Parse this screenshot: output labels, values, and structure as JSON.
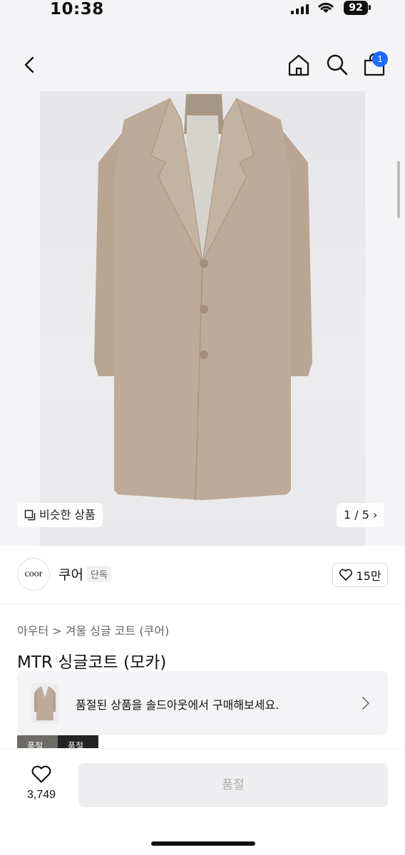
{
  "status": {
    "time": "10:38",
    "battery": "92"
  },
  "header": {
    "cart_count": "1"
  },
  "hero": {
    "similar_label": "비슷한 상품",
    "pager": "1 / 5 ›"
  },
  "brand": {
    "logo_text": "coor",
    "name": "쿠어",
    "tag": "단독",
    "likes": "15만"
  },
  "breadcrumb": "아우터 > 겨울 싱글 코트 (쿠어)",
  "product": {
    "title": "MTR 싱글코트 (모카)"
  },
  "banner": {
    "text": "품절된 상품을 솔드아웃에서 구매해보세요."
  },
  "chips": [
    "품절",
    "품절"
  ],
  "bottom": {
    "wish_count": "3,749",
    "buy_label": "품절"
  },
  "colors": {
    "accent": "#1f6bff",
    "coat": "#bdaa98"
  }
}
